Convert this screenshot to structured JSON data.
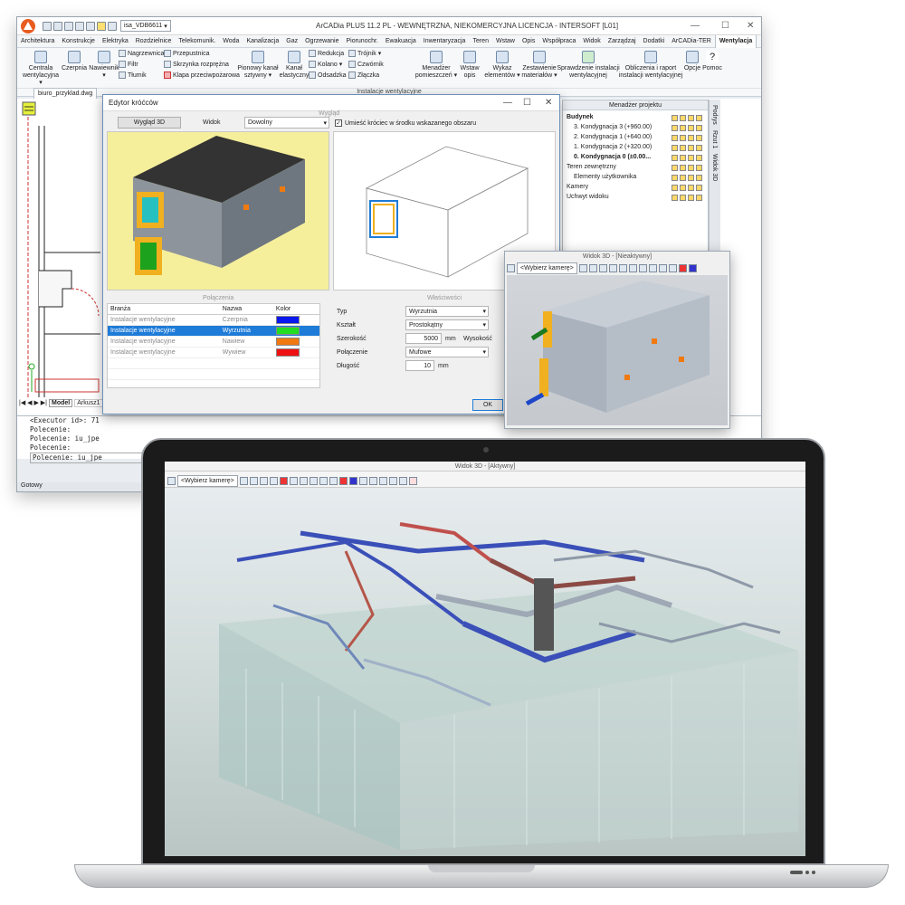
{
  "app": {
    "title": "ArCADia PLUS 11.2 PL - WEWNĘTRZNA, NIEKOMERCYJNA LICENCJA - INTERSOFT [L01]",
    "profile_combo": "isa_VDB6611",
    "menu": [
      "Architektura",
      "Konstrukcje",
      "Elektryka",
      "Rozdzielnice",
      "Telekomunik.",
      "Woda",
      "Kanalizacja",
      "Gaz",
      "Ogrzewanie",
      "Piorunochr.",
      "Ewakuacja",
      "Inwentaryzacja",
      "Teren",
      "Wstaw",
      "Opis",
      "Współpraca",
      "Widok",
      "Zarządzaj",
      "Dodatki",
      "ArCADia-TER",
      "Wentylacja"
    ],
    "active_menu": "Wentylacja",
    "ribbon": {
      "centrala": "Centrala wentylacyjna ▾",
      "czerpnia": "Czerpnia",
      "nawiewnik": "Nawiewnik ▾",
      "nagrzewnica": "Nagrzewnica",
      "filtr": "Filtr",
      "tlumik": "Tłumik",
      "przepustnica": "Przepustnica",
      "skrzynka": "Skrzynka rozprężna",
      "klapa": "Klapa przeciwpożarowa",
      "pionowy": "Pionowy kanał sztywny ▾",
      "kanal": "Kanał elastyczny",
      "redukcja": "Redukcja",
      "trojnik": "Trójnik ▾",
      "kolano": "Kolano ▾",
      "czwornik": "Czwórnik",
      "odsadzka": "Odsadzka",
      "zlaczka": "Złączka",
      "menadzer": "Menadżer pomieszczeń ▾",
      "wstaw_opis": "Wstaw opis",
      "wykaz": "Wykaz elementów ▾",
      "zestawienie": "Zestawienie materiałów ▾",
      "sprawdzenie": "Sprawdzenie instalacji wentylacyjnej",
      "obliczenia": "Obliczenia i raport instalacji wentylacyjnej",
      "opcje": "Opcje",
      "pomoc": "Pomoc",
      "group_label": "Instalacje wentylacyjne"
    },
    "doc_tab": "biuro_przyklad.dwg",
    "layout_tabs": [
      "Model",
      "Arkusz1"
    ],
    "command_lines": [
      "<Executor id>: 71",
      "Polecenie:",
      "Polecenie: iu_jpe",
      "Polecenie:",
      "Polecenie: iu_jpe"
    ],
    "status": "Gotowy"
  },
  "dialog": {
    "title": "Edytor króćców",
    "section_view": "Wygląd",
    "btn_3d": "Wygląd 3D",
    "view_label": "Widok",
    "view_value": "Dowolny",
    "checkbox_label": "Umieść króciec w środku wskazanego obszaru",
    "section_conn": "Połączenia",
    "cols": [
      "Branża",
      "Nazwa",
      "Kolor"
    ],
    "rows": [
      {
        "branza": "Instalacje wentylacyjne",
        "nazwa": "Czerpnia",
        "color": "#0a18ee"
      },
      {
        "branza": "Instalacje wentylacyjne",
        "nazwa": "Wyrzutnia",
        "color": "#22dd22"
      },
      {
        "branza": "Instalacje wentylacyjne",
        "nazwa": "Nawiew",
        "color": "#f07a10"
      },
      {
        "branza": "Instalacje wentylacyjne",
        "nazwa": "Wywiew",
        "color": "#ee1111"
      }
    ],
    "selected_row": 1,
    "section_props": "Właściwości",
    "typ_label": "Typ",
    "typ_value": "Wyrzutnia",
    "ksztalt_label": "Kształt",
    "ksztalt_value": "Prostokątny",
    "szer_label": "Szerokość",
    "szer_value": "5000",
    "unit_mm": "mm",
    "wys_label": "Wysokość",
    "pol_label": "Połączenie",
    "pol_value": "Mufowe",
    "dl_label": "Długość",
    "dl_value": "10",
    "ok": "OK"
  },
  "project_manager": {
    "title": "Menadżer projektu",
    "items": [
      "Budynek",
      "3. Kondygnacja 3 (+960.00)",
      "2. Kondygnacja 1 (+640.00)",
      "1. Kondygnacja 2 (+320.00)",
      "0. Kondygnacja 0 (±0.00...",
      "Teren zewnętrzny",
      "Elementy użytkownika",
      "Kamery",
      "Uchwyt widoku"
    ],
    "side_tabs": [
      "Podrys",
      "Rzut 1",
      "Widok 3D"
    ]
  },
  "view3d_small": {
    "title": "Widok 3D - [Nieaktywny]",
    "camera": "<Wybierz kamerę>"
  },
  "view3d_laptop": {
    "title": "Widok 3D - [Aktywny]",
    "camera": "<Wybierz kamerę>"
  }
}
